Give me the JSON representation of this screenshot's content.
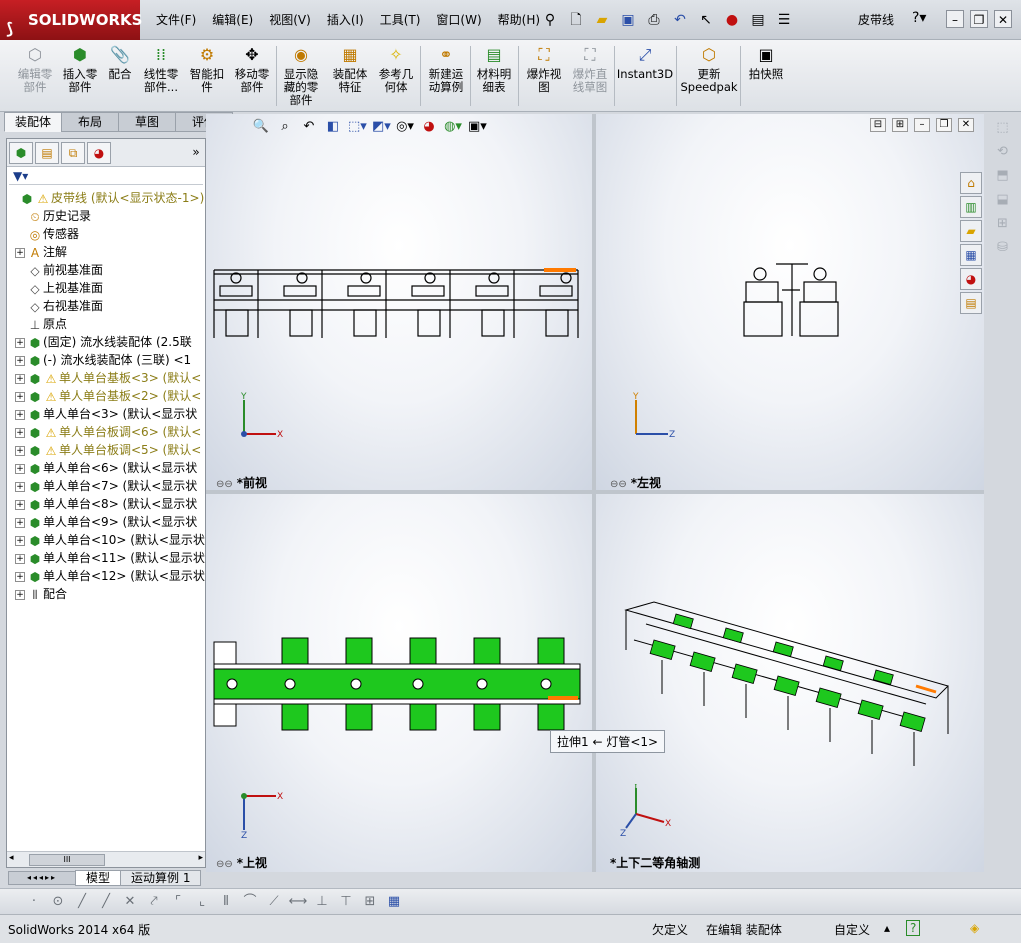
{
  "app": {
    "logo_text": "SOLIDWORKS",
    "document_title": "皮带线"
  },
  "menus": [
    "文件(F)",
    "编辑(E)",
    "视图(V)",
    "插入(I)",
    "工具(T)",
    "窗口(W)",
    "帮助(H)"
  ],
  "command_manager": {
    "buttons": [
      {
        "label": "编辑零\n部件",
        "icon": "edit-component-icon",
        "enabled": false
      },
      {
        "label": "插入零\n部件",
        "icon": "insert-component-icon",
        "enabled": true
      },
      {
        "label": "配合",
        "icon": "mate-icon",
        "enabled": true
      },
      {
        "label": "线性零\n部件...",
        "icon": "linear-pattern-icon",
        "enabled": true
      },
      {
        "label": "智能扣\n件",
        "icon": "smart-fasteners-icon",
        "enabled": true
      },
      {
        "label": "移动零\n部件",
        "icon": "move-component-icon",
        "enabled": true
      },
      {
        "label": "显示隐\n藏的零\n部件",
        "icon": "show-hidden-icon",
        "enabled": true
      },
      {
        "label": "装配体\n特征",
        "icon": "assembly-features-icon",
        "enabled": true
      },
      {
        "label": "参考几\n何体",
        "icon": "reference-geometry-icon",
        "enabled": true
      },
      {
        "label": "新建运\n动算例",
        "icon": "new-motion-study-icon",
        "enabled": true
      },
      {
        "label": "材料明\n细表",
        "icon": "bom-icon",
        "enabled": true
      },
      {
        "label": "爆炸视\n图",
        "icon": "exploded-view-icon",
        "enabled": true
      },
      {
        "label": "爆炸直\n线草图",
        "icon": "explode-line-sketch-icon",
        "enabled": false
      },
      {
        "label": "Instant3D",
        "icon": "instant3d-icon",
        "enabled": true
      },
      {
        "label": "更新\nSpeedpak",
        "icon": "speedpak-icon",
        "enabled": true
      },
      {
        "label": "拍快照",
        "icon": "snapshot-icon",
        "enabled": true
      }
    ],
    "tabs": [
      {
        "label": "装配体",
        "active": true
      },
      {
        "label": "布局",
        "active": false
      },
      {
        "label": "草图",
        "active": false
      },
      {
        "label": "评估",
        "active": false
      }
    ]
  },
  "feature_tree": {
    "root": "皮带线 (默认<显示状态-1>)",
    "nodes": [
      {
        "label": "历史记录",
        "icon": "history-icon",
        "expandable": false,
        "warn": false
      },
      {
        "label": "传感器",
        "icon": "sensor-icon",
        "expandable": false,
        "warn": false
      },
      {
        "label": "注解",
        "icon": "annotations-icon",
        "expandable": true,
        "warn": false
      },
      {
        "label": "前视基准面",
        "icon": "plane-icon",
        "expandable": false,
        "warn": false
      },
      {
        "label": "上视基准面",
        "icon": "plane-icon",
        "expandable": false,
        "warn": false
      },
      {
        "label": "右视基准面",
        "icon": "plane-icon",
        "expandable": false,
        "warn": false
      },
      {
        "label": "原点",
        "icon": "origin-icon",
        "expandable": false,
        "warn": false
      },
      {
        "label": "(固定) 流水线装配体 (2.5联",
        "icon": "subassembly-icon",
        "expandable": true,
        "warn": false
      },
      {
        "label": "(-) 流水线装配体 (三联) <1",
        "icon": "subassembly-icon",
        "expandable": true,
        "warn": false
      },
      {
        "label": "单人单台基板<3> (默认<",
        "icon": "subassembly-icon",
        "expandable": true,
        "warn": true
      },
      {
        "label": "单人单台基板<2> (默认<",
        "icon": "subassembly-icon",
        "expandable": true,
        "warn": true
      },
      {
        "label": "单人单台<3> (默认<显示状",
        "icon": "subassembly-icon",
        "expandable": true,
        "warn": false
      },
      {
        "label": "单人单台板调<6> (默认<",
        "icon": "subassembly-icon",
        "expandable": true,
        "warn": true
      },
      {
        "label": "单人单台板调<5> (默认<",
        "icon": "subassembly-icon",
        "expandable": true,
        "warn": true
      },
      {
        "label": "单人单台<6> (默认<显示状",
        "icon": "subassembly-icon",
        "expandable": true,
        "warn": false
      },
      {
        "label": "单人单台<7> (默认<显示状",
        "icon": "subassembly-icon",
        "expandable": true,
        "warn": false
      },
      {
        "label": "单人单台<8> (默认<显示状",
        "icon": "subassembly-icon",
        "expandable": true,
        "warn": false
      },
      {
        "label": "单人单台<9> (默认<显示状",
        "icon": "subassembly-icon",
        "expandable": true,
        "warn": false
      },
      {
        "label": "单人单台<10> (默认<显示状",
        "icon": "subassembly-icon",
        "expandable": true,
        "warn": false
      },
      {
        "label": "单人单台<11> (默认<显示状",
        "icon": "subassembly-icon",
        "expandable": true,
        "warn": false
      },
      {
        "label": "单人单台<12> (默认<显示状",
        "icon": "subassembly-icon",
        "expandable": true,
        "warn": false
      },
      {
        "label": "配合",
        "icon": "mates-icon",
        "expandable": true,
        "warn": false
      }
    ]
  },
  "viewports": {
    "top_left": "*前视",
    "top_right": "*左视",
    "bottom_left": "*上视",
    "bottom_right": "*上下二等角轴测"
  },
  "tooltip": "拉伸1 ← 灯管<1>",
  "bottom_tabs": [
    {
      "label": "模型",
      "active": true
    },
    {
      "label": "运动算例 1",
      "active": false
    }
  ],
  "status_bar": {
    "version": "SolidWorks 2014 x64 版",
    "definition": "欠定义",
    "editing": "在编辑 装配体",
    "units": "自定义"
  },
  "colors": {
    "accent_green": "#1ec81e",
    "warning_text": "#8b7d17",
    "highlight_orange": "#ff7a00"
  }
}
